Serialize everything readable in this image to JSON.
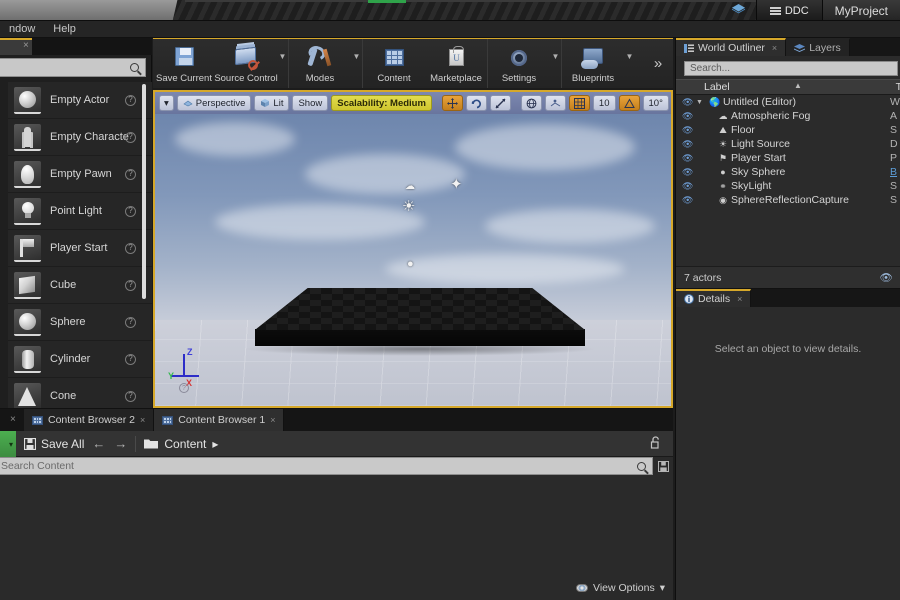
{
  "titlebar": {
    "project_name": "MyProject",
    "ddc_label": "DDC",
    "unreal_icon": "unreal-logo-icon"
  },
  "menubar": {
    "items": [
      {
        "label": "ndow"
      },
      {
        "label": "Help"
      }
    ]
  },
  "modes_panel": {
    "tab_close": "×",
    "search_placeholder": "",
    "actors": [
      {
        "label": "Empty Actor",
        "icon": "sphere-thumb",
        "help": "?"
      },
      {
        "label": "Empty Characte",
        "icon": "character-thumb",
        "help": "?"
      },
      {
        "label": "Empty Pawn",
        "icon": "pawn-thumb",
        "help": "?"
      },
      {
        "label": "Point Light",
        "icon": "bulb-thumb",
        "help": "?"
      },
      {
        "label": "Player Start",
        "icon": "flag-thumb",
        "help": "?"
      },
      {
        "label": "Cube",
        "icon": "cube-thumb",
        "help": "?"
      },
      {
        "label": "Sphere",
        "icon": "sphere-thumb",
        "help": "?"
      },
      {
        "label": "Cylinder",
        "icon": "cylinder-thumb",
        "help": "?"
      },
      {
        "label": "Cone",
        "icon": "cone-thumb",
        "help": "?"
      }
    ]
  },
  "toolbar": {
    "buttons": [
      {
        "label": "Save Current",
        "icon": "floppy-disk-icon",
        "dropdown": false
      },
      {
        "label": "Source Control",
        "icon": "source-control-icon",
        "dropdown": true
      },
      {
        "label": "Modes",
        "icon": "wrench-icon",
        "dropdown": true
      },
      {
        "label": "Content",
        "icon": "content-grid-icon",
        "dropdown": false
      },
      {
        "label": "Marketplace",
        "icon": "shopping-bag-icon",
        "dropdown": false
      },
      {
        "label": "Settings",
        "icon": "gear-icon",
        "dropdown": true
      },
      {
        "label": "Blueprints",
        "icon": "gamepad-icon",
        "dropdown": true
      }
    ],
    "overflow": "»"
  },
  "viewport": {
    "toolbar": {
      "menu_arrow": "▾",
      "camera_mode": "Perspective",
      "view_mode": "Lit",
      "show": "Show",
      "scalability": "Scalability: Medium",
      "grid_snap_value": "10",
      "rotation_snap_value": "10°",
      "overflow": "»"
    },
    "axis_gizmo": {
      "x": "X",
      "y": "Y",
      "z": "Z"
    }
  },
  "outliner": {
    "tabs": [
      {
        "label": "World Outliner",
        "icon": "list-icon",
        "active": true,
        "close": "×"
      },
      {
        "label": "Layers",
        "icon": "layers-icon",
        "active": false,
        "close": ""
      }
    ],
    "search_placeholder": "Search...",
    "columns": {
      "label": "Label",
      "type": "T"
    },
    "rows": [
      {
        "name": "Untitled (Editor)",
        "type": "W",
        "icon": "world-icon",
        "depth": 0,
        "expander": "▼",
        "link": false
      },
      {
        "name": "Atmospheric Fog",
        "type": "A",
        "icon": "fog-icon",
        "depth": 1,
        "expander": "",
        "link": false
      },
      {
        "name": "Floor",
        "type": "S",
        "icon": "mesh-icon",
        "depth": 1,
        "expander": "",
        "link": false
      },
      {
        "name": "Light Source",
        "type": "D",
        "icon": "sun-icon",
        "depth": 1,
        "expander": "",
        "link": false
      },
      {
        "name": "Player Start",
        "type": "P",
        "icon": "playerstart-icon",
        "depth": 1,
        "expander": "",
        "link": false
      },
      {
        "name": "Sky Sphere",
        "type": "B",
        "icon": "sphere-icon",
        "depth": 1,
        "expander": "",
        "link": true
      },
      {
        "name": "SkyLight",
        "type": "S",
        "icon": "skylight-icon",
        "depth": 1,
        "expander": "",
        "link": false
      },
      {
        "name": "SphereReflectionCapture",
        "type": "S",
        "icon": "reflection-icon",
        "depth": 1,
        "expander": "",
        "link": false
      }
    ],
    "footer": {
      "count": "7 actors",
      "eye_icon": "eye-icon"
    }
  },
  "details": {
    "tab": {
      "label": "Details",
      "icon": "info-icon",
      "close": "×"
    },
    "empty_message": "Select an object to view details."
  },
  "content_browser": {
    "tabs": [
      {
        "label": "Content Browser 2",
        "active": false,
        "close": "×"
      },
      {
        "label": "Content Browser 1",
        "active": true,
        "close": "×"
      }
    ],
    "toolbar": {
      "dropdown_arrow": "▾",
      "save_all": "Save All",
      "back": "←",
      "forward": "→",
      "folder_icon": "folder-icon",
      "path": "Content",
      "path_arrow": "▸",
      "lock_icon": "unlock-icon"
    },
    "search_placeholder": "Search Content",
    "save_filter_icon": "save-icon",
    "view_options": {
      "label": "View Options",
      "arrow": "▾",
      "icon": "eye-icon"
    }
  },
  "colors": {
    "accent_yellow": "#d6a82a",
    "viewport_toolbar_blue": "#6e7aa3",
    "scalability_yellow": "#cfc62e",
    "save_all_green": "#4caf50",
    "outliner_link_blue": "#5b9bd5"
  }
}
